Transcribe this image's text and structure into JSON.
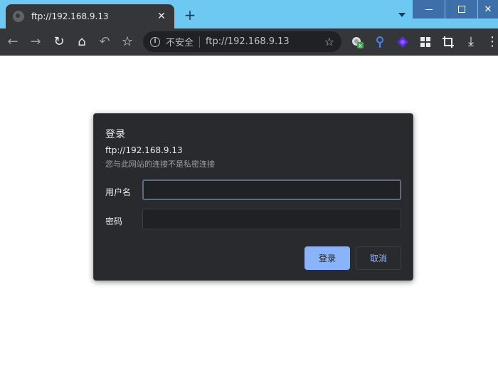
{
  "tab": {
    "title": "ftp://192.168.9.13",
    "close_glyph": "✕",
    "favicon": "globe-icon"
  },
  "tabstrip": {
    "new_tab_glyph": "+"
  },
  "window": {
    "close_glyph": "✕"
  },
  "toolbar": {
    "back_glyph": "←",
    "forward_glyph": "→",
    "reload_glyph": "↻",
    "home_glyph": "⌂",
    "undo_glyph": "↶",
    "star_glyph": "☆",
    "download_glyph": "⤓",
    "menu_glyph": "⋮"
  },
  "omnibox": {
    "security_label": "不安全",
    "info_glyph": "i",
    "url": "ftp://192.168.9.13",
    "bookmark_glyph": "☆"
  },
  "dialog": {
    "title": "登录",
    "origin": "ftp://192.168.9.13",
    "warning": "您与此网站的连接不是私密连接",
    "username_label": "用户名",
    "username_value": "",
    "password_label": "密码",
    "password_value": "",
    "login_button": "登录",
    "cancel_button": "取消"
  },
  "colors": {
    "tabstrip_bg": "#6ec9f2",
    "toolbar_bg": "#35363a",
    "dialog_bg": "#292a2d",
    "accent": "#8ab4f8"
  }
}
